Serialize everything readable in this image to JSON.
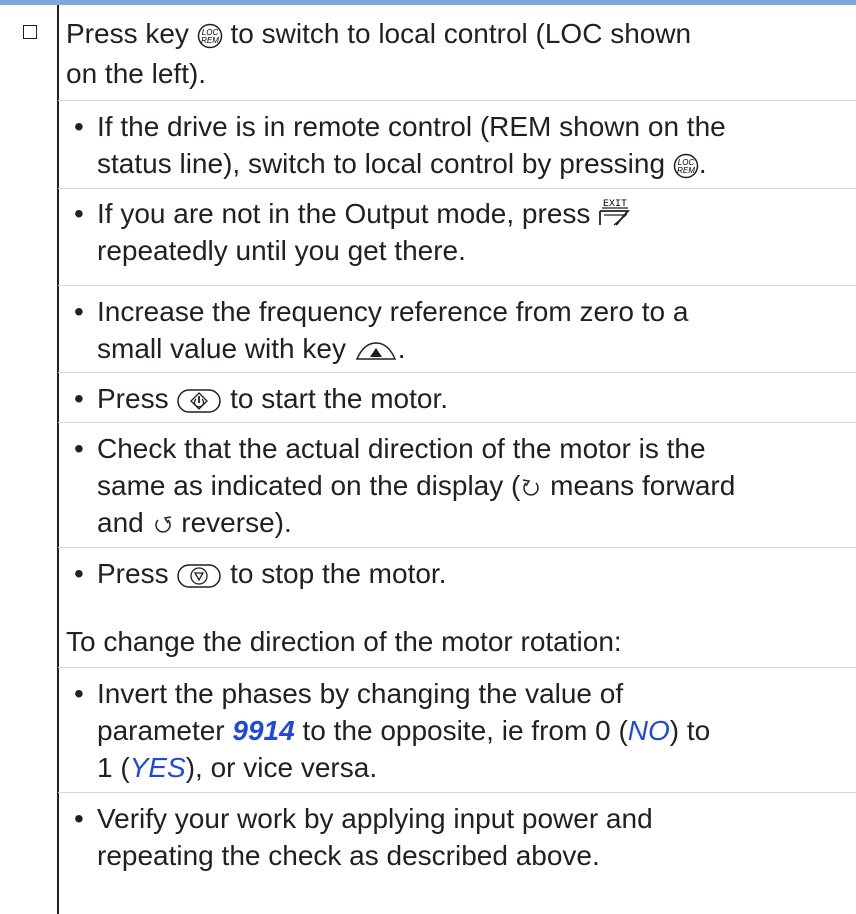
{
  "colors": {
    "topbar": "#7fa8d8",
    "link": "#1f48e0",
    "text": "#231f20"
  },
  "step": {
    "line1": {
      "a": "Press key",
      "b": "to switch to local control (LOC shown"
    },
    "line2": "on the left)."
  },
  "bullets": {
    "b1": {
      "l1": "If the drive is in remote control (REM shown on the",
      "l2a": "status line), switch to local control by pressing",
      "l2b": "."
    },
    "b2": {
      "l1": "If you are not in the Output mode, press",
      "l2": "repeatedly until you get there."
    },
    "b3": {
      "l1": "Increase the frequency reference from zero to a",
      "l2a": "small value with key",
      "l2b": "."
    },
    "b4": {
      "a": "Press",
      "b": "to start the motor."
    },
    "b5": {
      "l1": "Check that the actual direction of the motor is the",
      "l2a": "same as indicated on the display (",
      "l2b": "means forward",
      "l3a": "and",
      "l3b": "reverse)."
    },
    "b6": {
      "a": "Press",
      "b": "to stop the motor."
    }
  },
  "change_heading": "To change the direction of the motor rotation:",
  "bullets2": {
    "c1": {
      "l1": "Invert the phases by changing the value of",
      "l2a": "parameter",
      "param": "9914",
      "l2b": "to the opposite, ie from 0 (",
      "no": "NO",
      "l2c": ") to",
      "l3a": "1 (",
      "yes": "YES",
      "l3b": "), or vice versa."
    },
    "c2": {
      "l1": "Verify your work by applying input power and",
      "l2": "repeating the check as described above."
    }
  },
  "icons": {
    "locrem": "loc-rem-key-icon",
    "exit": "exit-key-icon",
    "exit_label": "EXIT",
    "up": "up-arrow-key-icon",
    "start": "start-key-icon",
    "stop": "stop-key-icon",
    "fwd": "forward-rotation-icon",
    "rev": "reverse-rotation-icon",
    "loc_text": "LOC",
    "rem_text": "REM"
  }
}
